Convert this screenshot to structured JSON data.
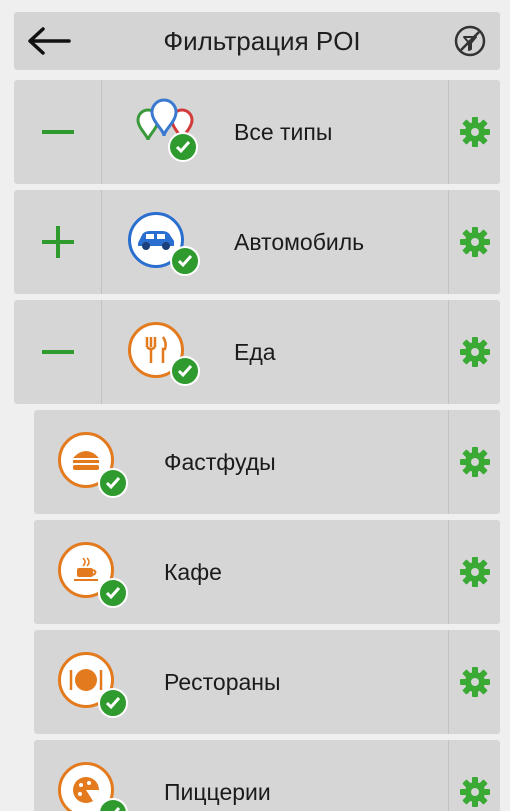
{
  "header": {
    "title": "Фильтрация POI",
    "back_icon": "arrow-left-icon",
    "clear_icon": "no-filter-icon"
  },
  "categories": [
    {
      "id": "all",
      "label": "Все типы",
      "toggle": "minus",
      "icon": "multi-pin-icon",
      "checked": true
    },
    {
      "id": "car",
      "label": "Автомобиль",
      "toggle": "plus",
      "icon": "car-icon",
      "checked": true
    },
    {
      "id": "food",
      "label": "Еда",
      "toggle": "minus",
      "icon": "cutlery-icon",
      "checked": true
    }
  ],
  "subcategories": [
    {
      "id": "fastfood",
      "label": "Фастфуды",
      "icon": "burger-icon",
      "checked": true
    },
    {
      "id": "cafe",
      "label": "Кафе",
      "icon": "coffee-icon",
      "checked": true
    },
    {
      "id": "restaurants",
      "label": "Рестораны",
      "icon": "plate-icon",
      "checked": true
    },
    {
      "id": "pizza",
      "label": "Пиццерии",
      "icon": "pizza-icon",
      "checked": true
    }
  ],
  "colors": {
    "accent_green": "#2f9a2e",
    "gear_green": "#3aaa35",
    "orange": "#e47a1e",
    "blue": "#2a6fd0",
    "row_bg": "#d6d6d6"
  }
}
